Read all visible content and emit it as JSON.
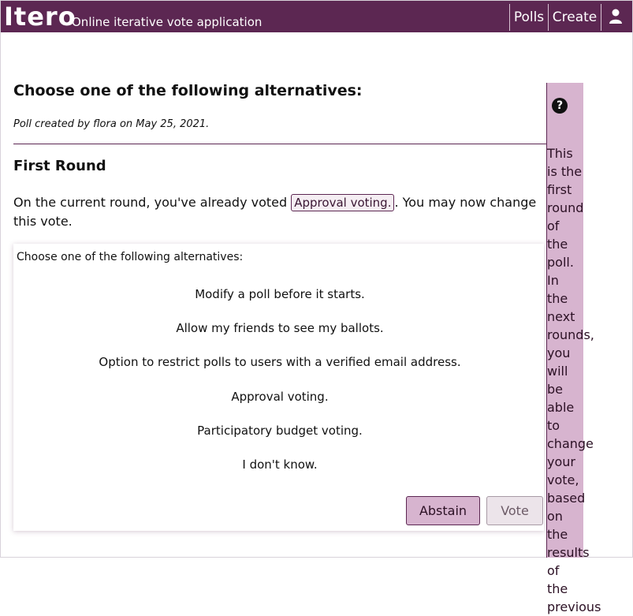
{
  "header": {
    "brand": "Itero",
    "tagline": "Online iterative vote application",
    "nav": {
      "polls": "Polls",
      "create": "Create",
      "user_icon": "user-icon"
    }
  },
  "poll": {
    "title": "Choose one of the following alternatives:",
    "meta": "Poll created by flora on May 25, 2021."
  },
  "round": {
    "title": "First Round",
    "voted_prefix": "On the current round, you've already voted",
    "voted_choice": "Approval voting.",
    "voted_suffix": ". You may now change this vote."
  },
  "ballot": {
    "label": "Choose one of the following alternatives:",
    "options": [
      "Modify a poll before it starts.",
      "Allow my friends to see my ballots.",
      "Option to restrict polls to users with a verified email address.",
      "Approval voting.",
      "Participatory budget voting.",
      "I don't know."
    ],
    "abstain_label": "Abstain",
    "vote_label": "Vote"
  },
  "help": {
    "icon": "question-icon",
    "glyph": "?",
    "text": "This is the first round of the poll. In the next rounds, you will be able to change your vote, based on the results of the previous"
  },
  "colors": {
    "brand": "#5c2752",
    "accent_light": "#d7b4cf"
  }
}
